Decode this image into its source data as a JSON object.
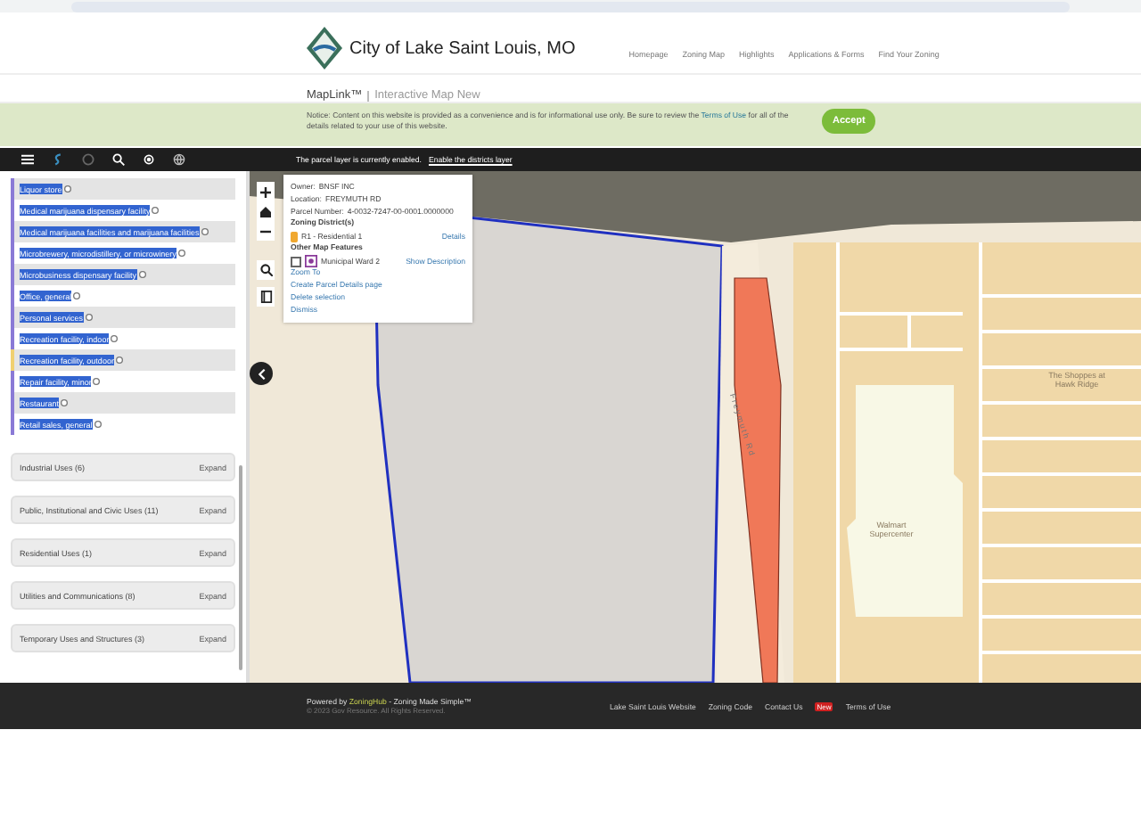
{
  "header": {
    "site_title": "City of Lake Saint Louis, MO",
    "nav": [
      "Homepage",
      "Zoning Map",
      "Highlights",
      "Applications & Forms",
      "Find Your Zoning"
    ],
    "app_title": "MapLink™",
    "app_subtitle": "Interactive Map New"
  },
  "notice": {
    "text": "Notice: Content on this website is provided as a convenience and is for informational use only. Be sure to review the **Terms of Use** for all of the details related to your use of this website.",
    "button": "Accept"
  },
  "toolbar": {
    "message": "The parcel layer is currently enabled.",
    "link": "Enable the districts layer"
  },
  "sidebar": {
    "uses": [
      {
        "label": "Liquor store",
        "color": "#8a7ad6"
      },
      {
        "label": "Medical marijuana dispensary facility",
        "color": "#8a7ad6"
      },
      {
        "label": "Medical marijuana facilities and marijuana facilities",
        "color": "#8a7ad6"
      },
      {
        "label": "Microbrewery, microdistillery, or microwinery",
        "color": "#8a7ad6"
      },
      {
        "label": "Microbusiness dispensary facility",
        "color": "#8a7ad6"
      },
      {
        "label": "Office, general",
        "color": "#8a7ad6"
      },
      {
        "label": "Personal services",
        "color": "#8a7ad6"
      },
      {
        "label": "Recreation facility, indoor",
        "color": "#8a7ad6"
      },
      {
        "label": "Recreation facility, outdoor",
        "color": "#f0d070"
      },
      {
        "label": "Repair facility, minor",
        "color": "#8a7ad6"
      },
      {
        "label": "Restaurant",
        "color": "#8a7ad6"
      },
      {
        "label": "Retail sales, general",
        "color": "#8a7ad6"
      }
    ],
    "categories": [
      {
        "label": "Industrial Uses (6)",
        "action": "Expand",
        "expanded": false
      },
      {
        "label": "Public, Institutional and Civic Uses (11)",
        "action": "Expand",
        "expanded": false
      },
      {
        "label": "Residential Uses (1)",
        "action": "Expand",
        "expanded": false
      },
      {
        "label": "Utilities and Communications (8)",
        "action": "Expand",
        "expanded": false
      },
      {
        "label": "Temporary Uses and Structures (3)",
        "action": "Expand",
        "expanded": false
      }
    ]
  },
  "popup": {
    "fields": [
      {
        "label": "Owner:",
        "value": "BNSF INC"
      },
      {
        "label": "Location:",
        "value": "FREYMUTH RD"
      },
      {
        "label": "Parcel Number:",
        "value": "4-0032-7247-00-0001.0000000"
      }
    ],
    "districts_heading": "Zoning District(s)",
    "district": {
      "name": "R1 - Residential 1",
      "link": "Details",
      "color": "#f0a830"
    },
    "features_heading": "Other Map Features",
    "feature": {
      "name": "Municipal Ward 2",
      "link": "Show Description",
      "checked": false
    },
    "actions": [
      "Zoom To",
      "Create Parcel Details page",
      "Delete selection",
      "Dismiss"
    ]
  },
  "map": {
    "labels": [
      {
        "kind": "road",
        "text": "Freymuth Rd"
      },
      {
        "kind": "place",
        "text": "The Shoppes at Hawk Ridge"
      },
      {
        "kind": "place",
        "text": "Walmart Supercenter"
      }
    ]
  },
  "footer": {
    "powered": "Powered by **ZoningHub** - Zoning Made Simple™",
    "copyright": "© 2023 Gov Resource. All Rights Reserved.",
    "links": [
      {
        "text": "Lake Saint Louis Website"
      },
      {
        "text": "Zoning Code"
      },
      {
        "text": "Contact Us"
      },
      {
        "text": "Terms of Use",
        "badge": "New"
      }
    ]
  }
}
